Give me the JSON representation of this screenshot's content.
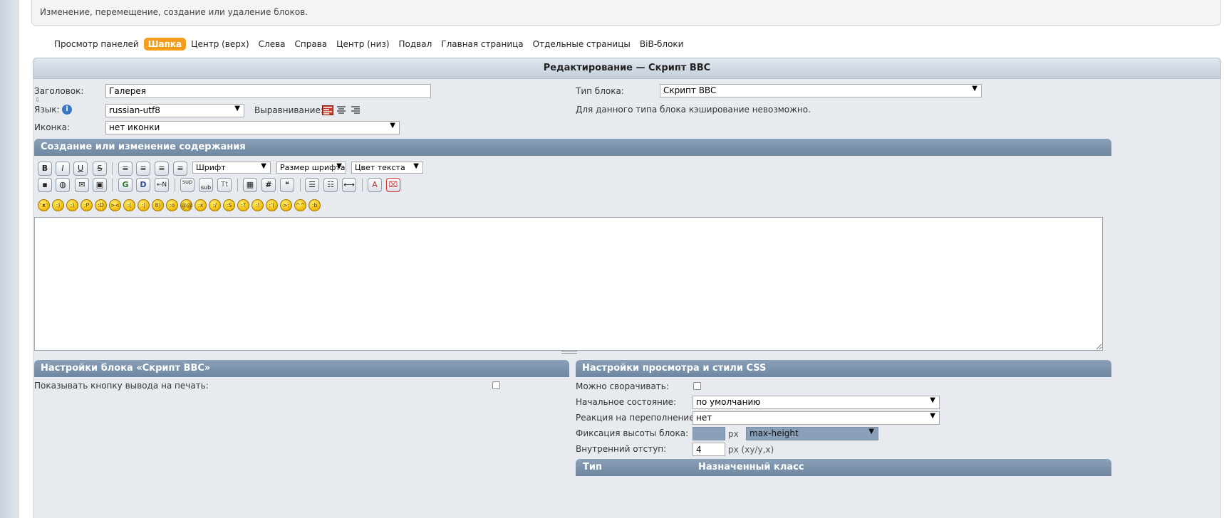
{
  "notice": "Изменение, перемещение, создание или удаление блоков.",
  "nav": [
    {
      "label": "Просмотр панелей",
      "active": false
    },
    {
      "label": "Шапка",
      "active": true
    },
    {
      "label": "Центр (верх)",
      "active": false
    },
    {
      "label": "Слева",
      "active": false
    },
    {
      "label": "Справа",
      "active": false
    },
    {
      "label": "Центр (низ)",
      "active": false
    },
    {
      "label": "Подвал",
      "active": false
    },
    {
      "label": "Главная страница",
      "active": false
    },
    {
      "label": "Отдельные страницы",
      "active": false
    },
    {
      "label": "BiB-блоки",
      "active": false
    }
  ],
  "main_title": "Редактирование — Скрипт BBC",
  "form": {
    "title_label": "Заголовок:",
    "title_value": "Галерея",
    "lang_label": "Язык:",
    "lang_value": "russian-utf8",
    "align_label": "Выравнивание:",
    "icon_label": "Иконка:",
    "icon_value": "нет иконки",
    "type_label": "Тип блока:",
    "type_value": "Скрипт BBC",
    "cache_note": "Для данного типа блока кэширование невозможно."
  },
  "content_header": "Создание или изменение содержания",
  "toolbar": {
    "bold": "B",
    "italic": "I",
    "underline": "U",
    "strike": "S",
    "font_select": "Шрифт",
    "size_select": "Размер шрифта",
    "color_select": "Цвет текста",
    "sup": "sup",
    "sub": "sub",
    "tt": "Tt",
    "hash": "#"
  },
  "block_settings": {
    "header": "Настройки блока «Скрипт BBC»",
    "print_label": "Показывать кнопку вывода на печать:"
  },
  "view_settings": {
    "header": "Настройки просмотра и стили CSS",
    "collapse_label": "Можно сворачивать:",
    "initial_label": "Начальное состояние:",
    "initial_value": "по умолчанию",
    "overflow_label": "Реакция на переполнение:",
    "overflow_value": "нет",
    "height_label": "Фиксация высоты блока:",
    "height_unit": "px",
    "height_mode": "max-height",
    "padding_label": "Внутренний отступ:",
    "padding_value": "4",
    "padding_unit": "px (xy/y,x)"
  },
  "table": {
    "col_type": "Тип",
    "col_class": "Назначенный класс"
  },
  "colors": {
    "accent": "#f59c1a",
    "header": "#7890aa",
    "panel": "#e7ebef"
  }
}
